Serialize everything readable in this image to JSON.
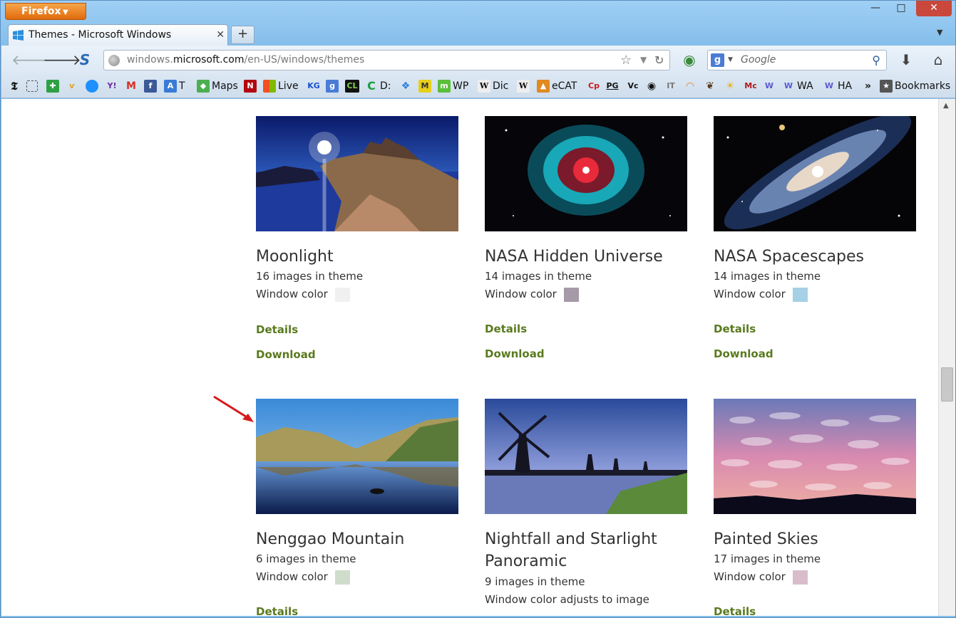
{
  "browser": {
    "menu_button": "Firefox",
    "tab_title": "Themes - Microsoft Windows",
    "url_prefix": "windows.",
    "url_domain": "microsoft.com",
    "url_path": "/en-US/windows/themes",
    "search_placeholder": "Google",
    "new_tab": "+"
  },
  "bookmarks": [
    {
      "label": "T",
      "icon": "translate-icon",
      "color": "#3a7bd5"
    },
    {
      "label": "Maps",
      "icon": "maps-icon",
      "color": "#4caf50"
    },
    {
      "label": "Live",
      "icon": "windows-live-icon",
      "color": "#f25022"
    },
    {
      "label": "D:",
      "icon": "chrome-icon",
      "color": "#1a9e3a"
    },
    {
      "label": "WP",
      "icon": "wp-icon",
      "color": "#5bbf3a"
    },
    {
      "label": "Dic",
      "icon": "wikipedia-icon",
      "color": "#888888"
    },
    {
      "label": "eCAT",
      "icon": "ecat-icon",
      "color": "#e08a20"
    },
    {
      "label": "WA",
      "icon": "wa-icon",
      "color": "#5a5ad0"
    },
    {
      "label": "HA",
      "icon": "ha-icon",
      "color": "#5a5ad0"
    },
    {
      "label": "Bookmarks",
      "icon": "bookmarks-star-icon",
      "color": "#555555"
    }
  ],
  "themes": [
    {
      "title": "Moonlight",
      "count": "16 images in theme",
      "color_label": "Window color",
      "swatch": "#f0f0f0",
      "details": "Details",
      "download": "Download"
    },
    {
      "title": "NASA Hidden Universe",
      "count": "14 images in theme",
      "color_label": "Window color",
      "swatch": "#a79aa8",
      "details": "Details",
      "download": "Download"
    },
    {
      "title": "NASA Spacescapes",
      "count": "14 images in theme",
      "color_label": "Window color",
      "swatch": "#a6d0e6",
      "details": "Details",
      "download": "Download"
    },
    {
      "title": "Nenggao Mountain",
      "count": "6 images in theme",
      "color_label": "Window color",
      "swatch": "#d0dccb",
      "details": "Details"
    },
    {
      "title_line1": "Nightfall and Starlight",
      "title_line2": "Panoramic",
      "count": "9 images in theme",
      "color_label": "Window color adjusts to image"
    },
    {
      "title": "Painted Skies",
      "count": "17 images in theme",
      "color_label": "Window color",
      "swatch": "#d9bccb",
      "details": "Details"
    }
  ]
}
